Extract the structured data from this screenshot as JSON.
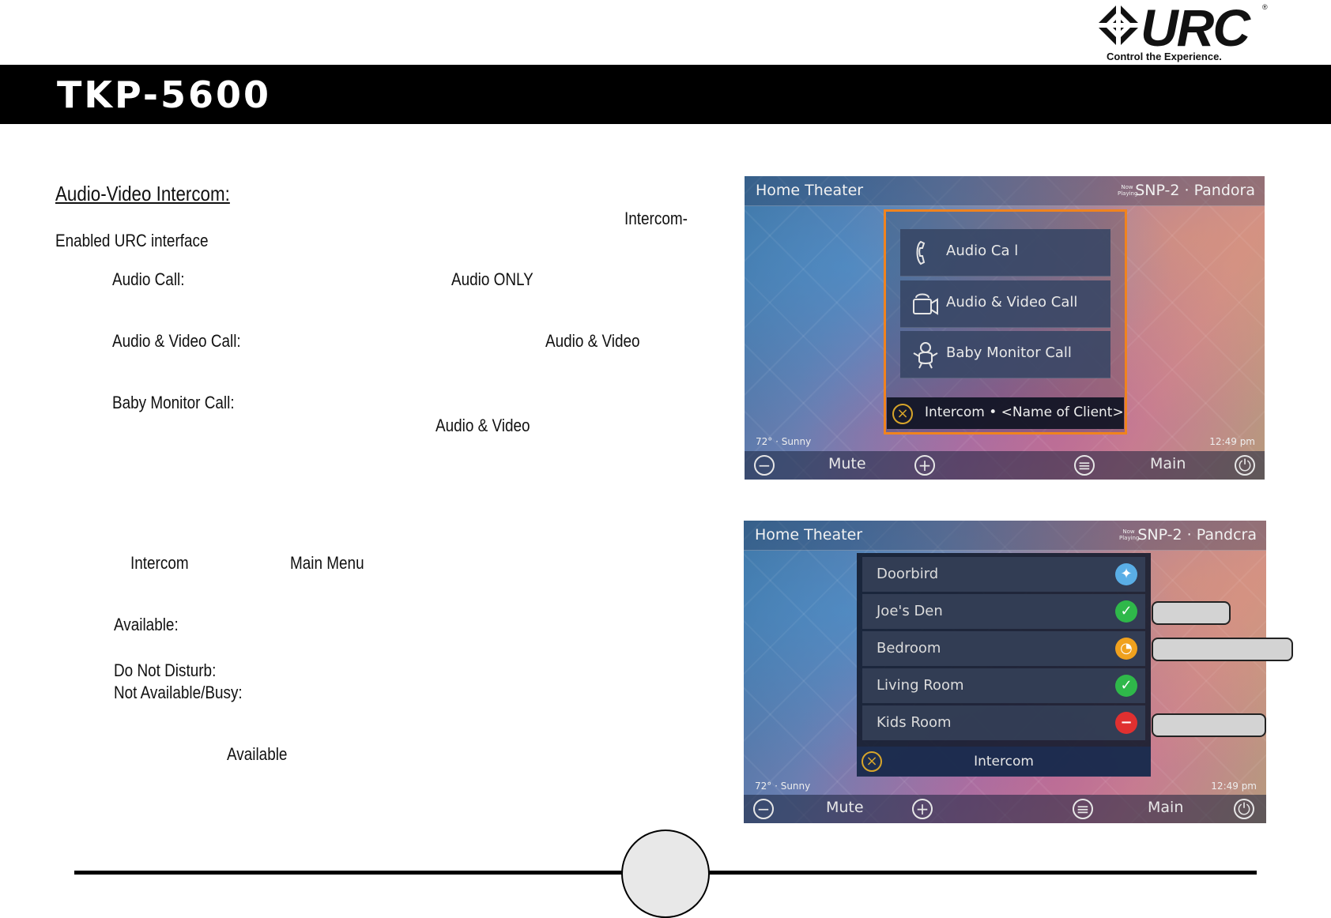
{
  "header": {
    "brand": "URC",
    "tagline": "Control the Experience.",
    "title": "TKP-5600"
  },
  "body_text": {
    "heading": "Audio-Video Intercom:",
    "intercom_fragment": "Intercom-",
    "enabled_fragment": "Enabled URC interface",
    "audio_call_label": "Audio Call:",
    "audio_only": "Audio ONLY",
    "av_call_label": "Audio & Video Call:",
    "av_1": "Audio & Video",
    "baby_monitor_label": "Baby Monitor Call:",
    "av_2": "Audio & Video",
    "intercom_word": "Intercom",
    "main_menu": "Main Menu",
    "available_label": "Available:",
    "dnd_label": "Do Not Disturb:",
    "not_available_label": "Not Available/Busy:",
    "available_word": "Available"
  },
  "screen1": {
    "room": "Home Theater",
    "now_playing": "Now Playing",
    "source": "SNP-2 · Pandora",
    "buttons": [
      {
        "label": "Audio Ca l",
        "icon": "phone-icon"
      },
      {
        "label": "Audio & Video Call",
        "icon": "video-call-icon"
      },
      {
        "label": "Baby Monitor Call",
        "icon": "baby-icon"
      }
    ],
    "footer_label": "Intercom • <Name of Client>",
    "weather": "72° · Sunny",
    "time": "12:49 pm",
    "mute": "Mute",
    "main": "Main"
  },
  "screen2": {
    "room": "Home Theater",
    "now_playing": "Now Playing",
    "source": "SNP-2 · Pandcra",
    "rows": [
      {
        "label": "Doorbird",
        "status": "doorbird",
        "color": "#5aaee6"
      },
      {
        "label": "Joe's Den",
        "status": "available",
        "color": "#2fb84a"
      },
      {
        "label": "Bedroom",
        "status": "do-not-disturb",
        "color": "#f0a11e"
      },
      {
        "label": "Living Room",
        "status": "available",
        "color": "#2fb84a"
      },
      {
        "label": "Kids Room",
        "status": "busy",
        "color": "#e03030"
      }
    ],
    "footer_label": "Intercom",
    "weather": "72° · Sunny",
    "time": "12:49 pm",
    "mute": "Mute",
    "main": "Main"
  },
  "colors": {
    "highlight": "#f0831e",
    "title_bar": "#000000"
  }
}
